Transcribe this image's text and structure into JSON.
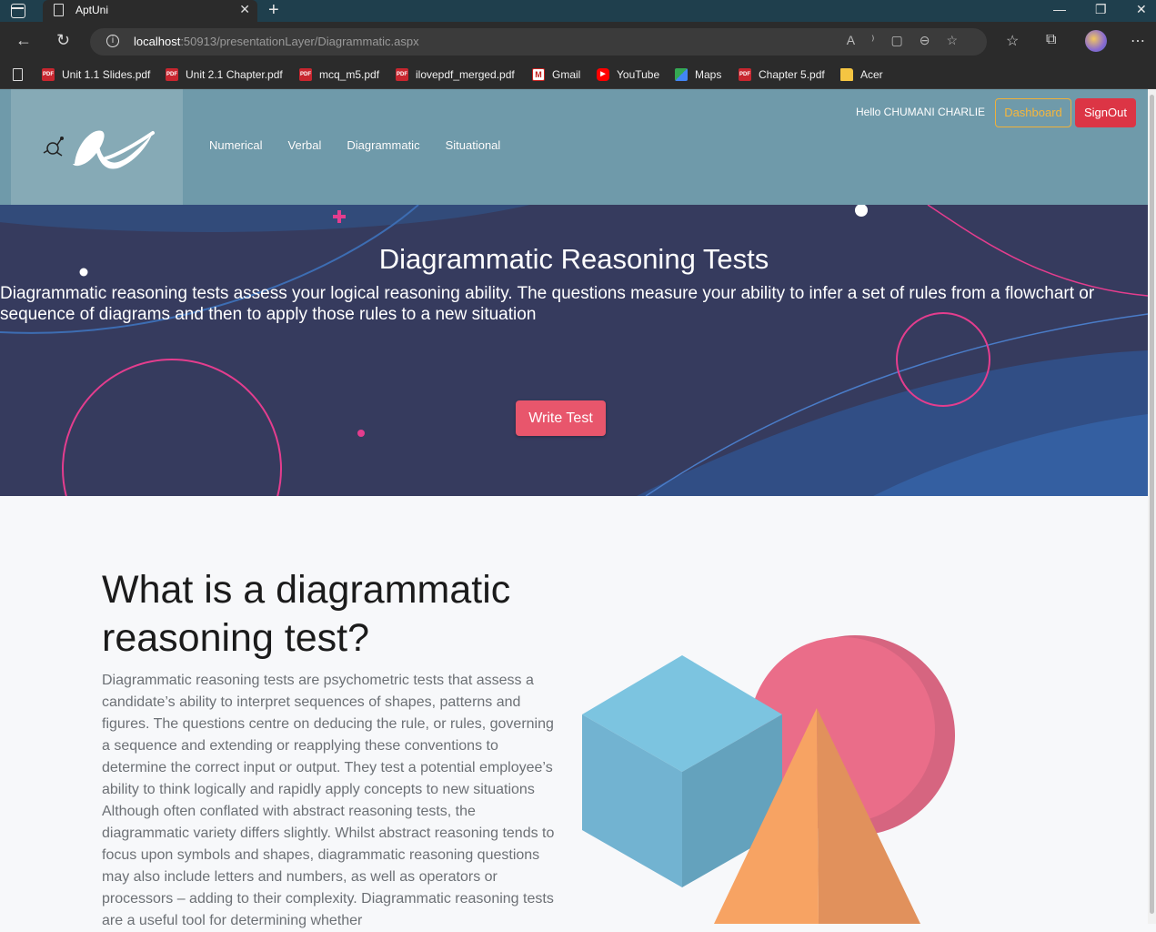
{
  "browser": {
    "tab_title": "AptUni",
    "url_host": "localhost",
    "url_path": ":50913/presentationLayer/Diagrammatic.aspx",
    "bookmarks": [
      {
        "label": "Unit 1.1 Slides.pdf",
        "icon": "pdf-icon"
      },
      {
        "label": "Unit 2.1 Chapter.pdf",
        "icon": "pdf-icon"
      },
      {
        "label": "mcq_m5.pdf",
        "icon": "pdf-icon"
      },
      {
        "label": "ilovepdf_merged.pdf",
        "icon": "pdf-icon"
      },
      {
        "label": "Gmail",
        "icon": "gmail-icon"
      },
      {
        "label": "YouTube",
        "icon": "youtube-icon"
      },
      {
        "label": "Maps",
        "icon": "maps-icon"
      },
      {
        "label": "Chapter 5.pdf",
        "icon": "pdf-icon"
      },
      {
        "label": "Acer",
        "icon": "folder-icon"
      }
    ]
  },
  "header": {
    "nav": [
      "Numerical",
      "Verbal",
      "Diagrammatic",
      "Situational"
    ],
    "greeting": "Hello CHUMANI CHARLIE",
    "dashboard_label": "Dashboard",
    "signout_label": "SignOut"
  },
  "hero": {
    "title": "Diagrammatic Reasoning Tests",
    "description": "Diagrammatic reasoning tests assess your logical reasoning ability. The questions measure your ability to infer a set of rules from a flowchart or sequence of diagrams and then to apply those rules to a new situation",
    "button_label": "Write Test"
  },
  "content": {
    "heading": "What is a diagrammatic reasoning test?",
    "paragraph": "Diagrammatic reasoning tests are psychometric tests that assess a candidate’s ability to interpret sequences of shapes, patterns and figures. The questions centre on deducing the rule, or rules, governing a sequence and extending or reapplying these conventions to determine the correct input or output. They test a potential employee’s ability to think logically and rapidly apply concepts to new situations Although often conflated with abstract reasoning tests, the diagrammatic variety differs slightly. Whilst abstract reasoning tends to focus upon symbols and shapes, diagrammatic reasoning questions may also include letters and numbers, as well as operators or processors – adding to their complexity. Diagrammatic reasoning tests are a useful tool for determining whether"
  },
  "colors": {
    "header_bg": "#6f9aaa",
    "hero_bg": "#363b5e",
    "accent_pink": "#e8566c",
    "dashboard_outline": "#f0b13a",
    "signout_bg": "#dc3545"
  }
}
